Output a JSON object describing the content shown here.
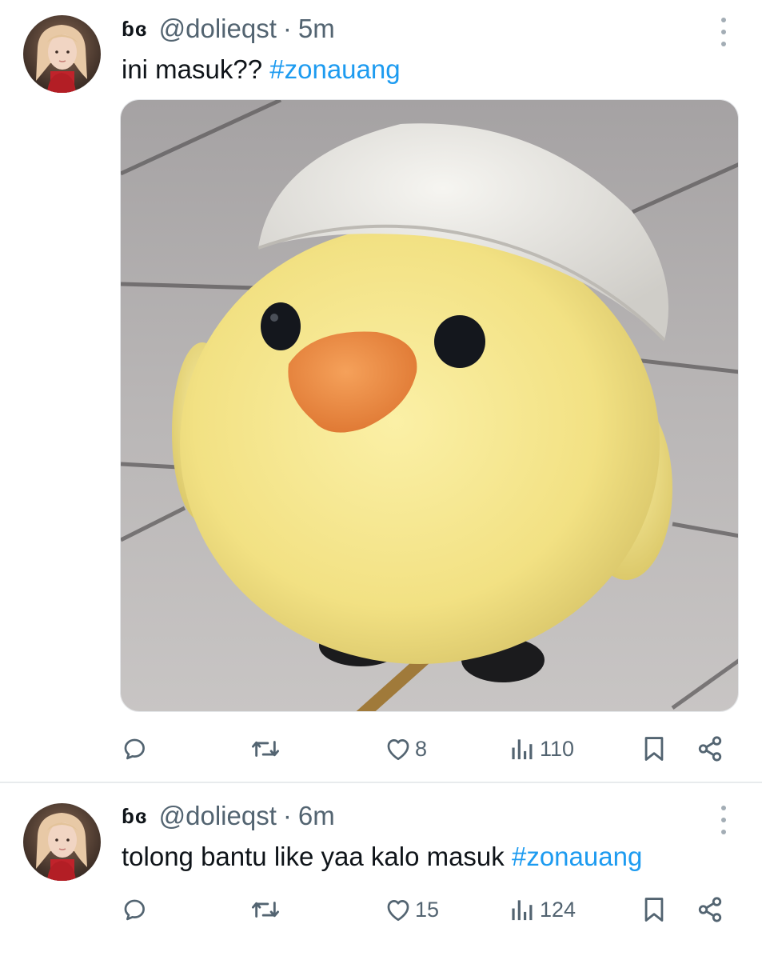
{
  "tweets": [
    {
      "display_name": "ɓɞ",
      "handle": "@dolieqst",
      "separator": "·",
      "time": "5m",
      "text": "ini masuk?? ",
      "hashtag": "#zonauang",
      "has_media": true,
      "media_description_icon": "chick-plush-photo",
      "reply_count": "",
      "retweet_count": "",
      "like_count": "8",
      "view_count": "110"
    },
    {
      "display_name": "ɓɞ",
      "handle": "@dolieqst",
      "separator": "·",
      "time": "6m",
      "text": "tolong bantu like yaa kalo masuk ",
      "hashtag": "#zonauang",
      "has_media": false,
      "reply_count": "",
      "retweet_count": "",
      "like_count": "15",
      "view_count": "124"
    }
  ],
  "icons": {
    "reply": "speech-bubble-icon",
    "retweet": "retweet-icon",
    "like": "heart-icon",
    "views": "bar-chart-icon",
    "bookmark": "bookmark-icon",
    "share": "share-icon",
    "more": "vertical-dots-icon"
  },
  "colors": {
    "hashtag": "#1d9bf0",
    "secondary_text": "#536471",
    "primary_text": "#0f1419",
    "divider": "#e8ebed"
  }
}
